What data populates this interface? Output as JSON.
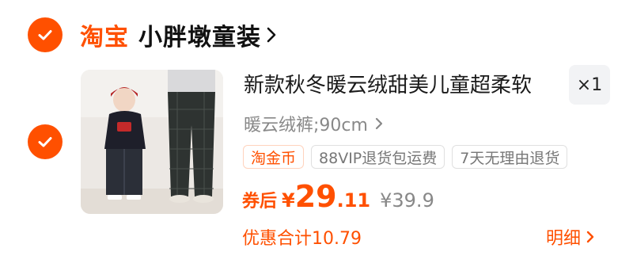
{
  "shop": {
    "platform_logo": "淘宝",
    "name": "小胖墩童装",
    "checked": true
  },
  "item": {
    "checked": true,
    "title": "新款秋冬暖云绒甜美儿童超柔软",
    "quantity": "×1",
    "sku": "暖云绒裤;90cm",
    "tags": [
      "淘金币",
      "88VIP退货包运费",
      "7天无理由退货"
    ],
    "price": {
      "label": "券后",
      "currency": "¥",
      "integer": "29",
      "decimal": ".11",
      "original": "¥39.9"
    },
    "discount": "优惠合计10.79",
    "detail_label": "明细"
  },
  "colors": {
    "accent": "#ff5000",
    "muted": "#888888"
  },
  "icons": {
    "check": "check-icon",
    "chevron": "chevron-right-icon"
  }
}
